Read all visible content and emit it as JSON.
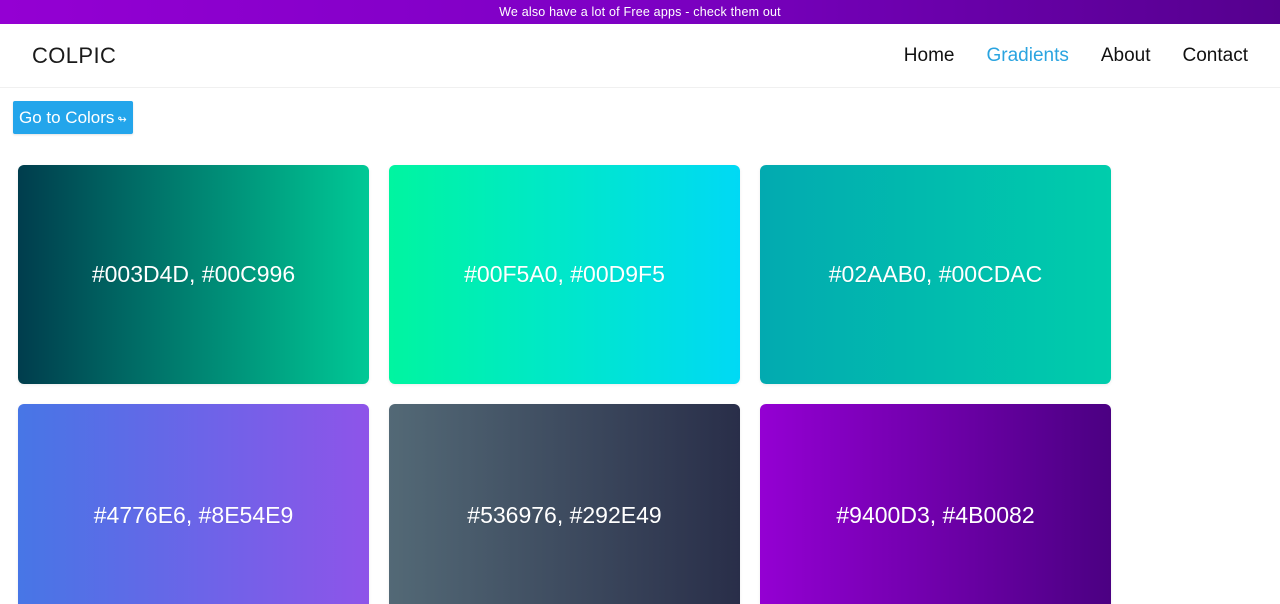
{
  "promo": {
    "text": "We also have a lot of Free apps - check them out"
  },
  "navbar": {
    "brand": "COLPIC",
    "links": [
      {
        "label": "Home",
        "active": false
      },
      {
        "label": "Gradients",
        "active": true
      },
      {
        "label": "About",
        "active": false
      },
      {
        "label": "Contact",
        "active": false
      }
    ]
  },
  "actions": {
    "go_colors_label": "Go to Colors",
    "go_colors_icon": "↬"
  },
  "gradients": [
    {
      "label": "#003D4D, #00C996",
      "from": "#003D4D",
      "to": "#00C996"
    },
    {
      "label": "#00F5A0, #00D9F5",
      "from": "#00F5A0",
      "to": "#00D9F5"
    },
    {
      "label": "#02AAB0, #00CDAC",
      "from": "#02AAB0",
      "to": "#00CDAC"
    },
    {
      "label": "#4776E6, #8E54E9",
      "from": "#4776E6",
      "to": "#8E54E9"
    },
    {
      "label": "#536976, #292E49",
      "from": "#536976",
      "to": "#292E49"
    },
    {
      "label": "#9400D3, #4B0082",
      "from": "#9400D3",
      "to": "#4B0082"
    }
  ],
  "colors": {
    "active_link": "#2aa4e0",
    "button_bg": "#23a5eb",
    "promo_from": "#9400D3",
    "promo_to": "#55008e"
  }
}
